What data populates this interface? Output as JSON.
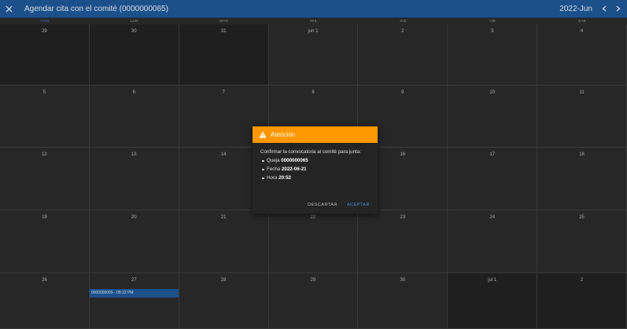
{
  "topbar": {
    "title": "Agendar cita con el comité (0000000065)",
    "month": "2022-Jun",
    "close_icon": "close-icon",
    "prev_icon": "chevron-left-icon",
    "next_icon": "chevron-right-icon"
  },
  "calendar": {
    "weekdays": [
      "DOM",
      "LUN",
      "MAR",
      "MIE",
      "JUE",
      "VIE",
      "SAB"
    ],
    "weeks": [
      [
        {
          "d": "29",
          "out": true
        },
        {
          "d": "30",
          "out": true
        },
        {
          "d": "31",
          "out": true
        },
        {
          "d": "jun 1"
        },
        {
          "d": "2"
        },
        {
          "d": "3"
        },
        {
          "d": "4"
        }
      ],
      [
        {
          "d": "5"
        },
        {
          "d": "6"
        },
        {
          "d": "7"
        },
        {
          "d": "8"
        },
        {
          "d": "9"
        },
        {
          "d": "10"
        },
        {
          "d": "11"
        }
      ],
      [
        {
          "d": "12"
        },
        {
          "d": "13"
        },
        {
          "d": "14"
        },
        {
          "d": "15"
        },
        {
          "d": "16"
        },
        {
          "d": "17"
        },
        {
          "d": "18"
        }
      ],
      [
        {
          "d": "19"
        },
        {
          "d": "20"
        },
        {
          "d": "21"
        },
        {
          "d": "22"
        },
        {
          "d": "23"
        },
        {
          "d": "24"
        },
        {
          "d": "25"
        }
      ],
      [
        {
          "d": "26"
        },
        {
          "d": "27",
          "event": "0000000065 - 08:32 PM"
        },
        {
          "d": "28"
        },
        {
          "d": "29"
        },
        {
          "d": "30"
        },
        {
          "d": "jul 1",
          "out": true
        },
        {
          "d": "2",
          "out": true
        }
      ]
    ]
  },
  "dialog": {
    "title": "Atención",
    "icon": "warning-icon",
    "message": "Confirmar la convocatoria al comité para junta:",
    "items": [
      {
        "label": "Queja",
        "value": "0000000065"
      },
      {
        "label": "Fecha",
        "value": "2022-06-21"
      },
      {
        "label": "Hora",
        "value": "20:52"
      }
    ],
    "discard_label": "DESCARTAR",
    "accept_label": "ACEPTAR"
  },
  "colors": {
    "topbar": "#1f5796",
    "accent": "#ff9800",
    "event": "#1f5796",
    "accept": "#3f8fe0"
  }
}
